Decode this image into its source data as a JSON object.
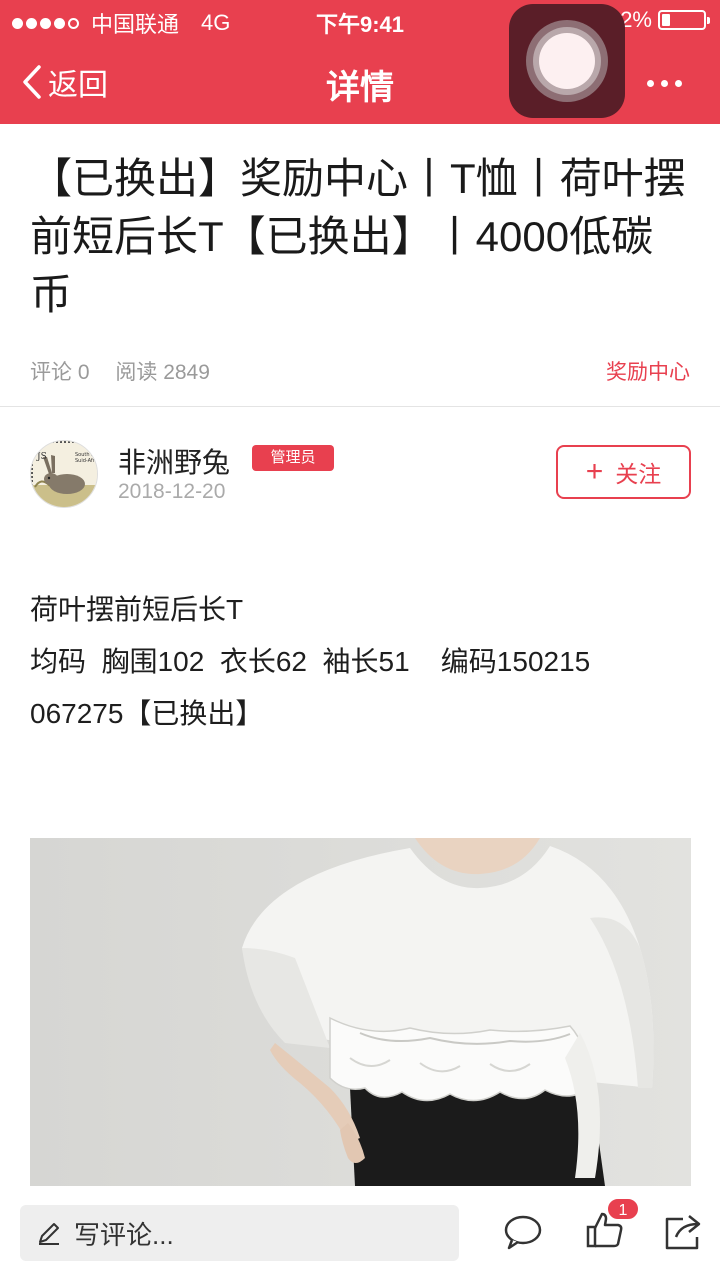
{
  "status_bar": {
    "carrier": "中国联通",
    "network": "4G",
    "time": "下午9:41",
    "battery": "22%"
  },
  "nav": {
    "back_label": "返回",
    "title": "详情"
  },
  "article": {
    "title": "【已换出】奖励中心丨T恤丨荷叶摆前短后长T【已换出】丨4000低碳币",
    "comments_label": "评论 0",
    "reads_label": "阅读 2849",
    "category": "奖励中心"
  },
  "author": {
    "name": "非洲野兔",
    "badge": "管理员",
    "date": "2018-12-20",
    "follow_label": "关注"
  },
  "body": {
    "lines": [
      "荷叶摆前短后长T",
      "均码  胸围102  衣长62  袖长51    编码150215",
      "067275【已换出】"
    ]
  },
  "bottom_bar": {
    "comment_placeholder": "写评论...",
    "like_count": "1"
  },
  "icons": {
    "back": "chevron-left-icon",
    "more": "more-dots-icon",
    "edit": "pencil-icon",
    "comment": "speech-bubble-icon",
    "like": "thumbs-up-icon",
    "share": "share-icon"
  },
  "colors": {
    "brand": "#e8404f",
    "muted_text": "#9a9a9a"
  }
}
